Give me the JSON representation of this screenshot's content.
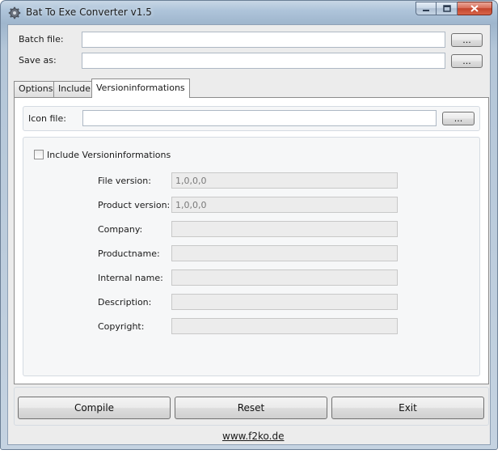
{
  "window": {
    "title": "Bat To Exe Converter v1.5",
    "caption_buttons": {
      "minimize": "minimize-icon",
      "maximize": "maximize-icon",
      "close": "close-icon"
    }
  },
  "files": {
    "batch_label": "Batch file:",
    "batch_value": "",
    "save_label": "Save as:",
    "save_value": "",
    "browse_label": "..."
  },
  "tabs": [
    {
      "label": "Options",
      "active": false
    },
    {
      "label": "Include",
      "active": false
    },
    {
      "label": "Versioninformations",
      "active": true
    }
  ],
  "version_tab": {
    "icon_label": "Icon file:",
    "icon_value": "",
    "browse_label": "...",
    "include_label": "Include Versioninformations",
    "include_checked": false,
    "fields": [
      {
        "label": "File version:",
        "value": "1,0,0,0"
      },
      {
        "label": "Product version:",
        "value": "1,0,0,0"
      },
      {
        "label": "Company:",
        "value": ""
      },
      {
        "label": "Productname:",
        "value": ""
      },
      {
        "label": "Internal name:",
        "value": ""
      },
      {
        "label": "Description:",
        "value": ""
      },
      {
        "label": "Copyright:",
        "value": ""
      }
    ]
  },
  "actions": {
    "compile": "Compile",
    "reset": "Reset",
    "exit": "Exit"
  },
  "footer": {
    "link": "www.f2ko.de"
  },
  "colors": {
    "title_bar": "#aec4da",
    "client_bg": "#ececec",
    "close_button": "#c2442c"
  }
}
